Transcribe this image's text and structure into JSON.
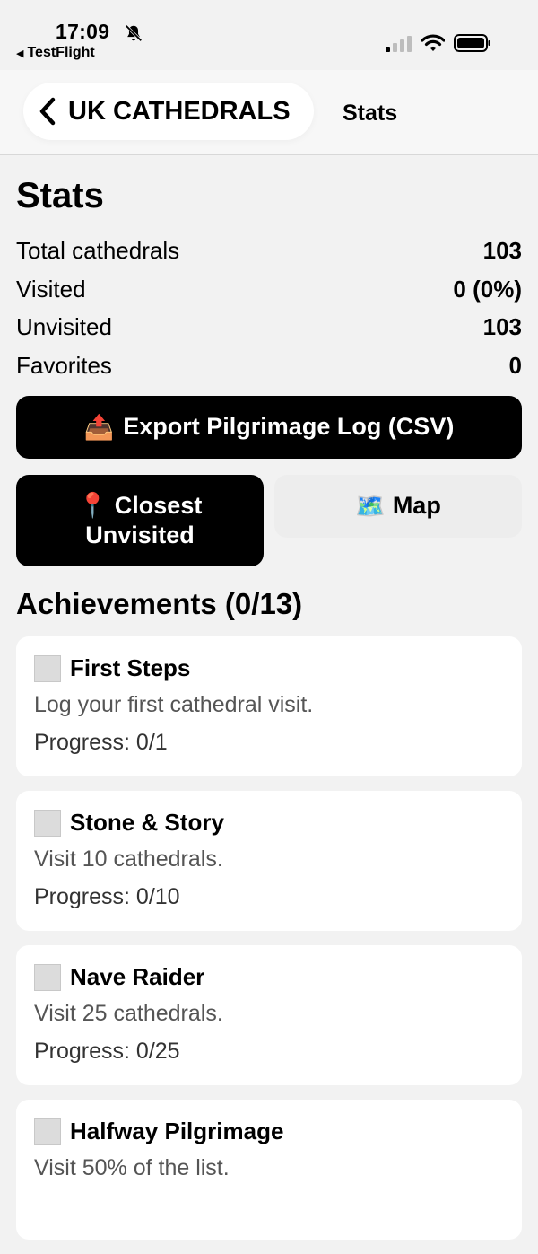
{
  "status_bar": {
    "time": "17:09",
    "back_app": "TestFlight",
    "icons": [
      "bell-slash-icon",
      "signal-icon",
      "wifi-icon",
      "battery-icon"
    ]
  },
  "nav": {
    "back_label": "UK CATHEDRALS",
    "title": "Stats"
  },
  "page": {
    "title": "Stats"
  },
  "stats": [
    {
      "label": "Total cathedrals",
      "value": "103"
    },
    {
      "label": "Visited",
      "value": "0 (0%)"
    },
    {
      "label": "Unvisited",
      "value": "103"
    },
    {
      "label": "Favorites",
      "value": "0"
    }
  ],
  "buttons": {
    "export": {
      "emoji": "📤",
      "label": "Export Pilgrimage Log (CSV)"
    },
    "closest": {
      "emoji": "📍",
      "line1": "Closest",
      "line2": "Unvisited"
    },
    "map": {
      "emoji": "🗺️",
      "label": "Map"
    }
  },
  "achievements": {
    "title": "Achievements (0/13)",
    "items": [
      {
        "title": "First Steps",
        "desc": "Log your first cathedral visit.",
        "progress": "Progress: 0/1"
      },
      {
        "title": "Stone & Story",
        "desc": "Visit 10 cathedrals.",
        "progress": "Progress: 0/10"
      },
      {
        "title": "Nave Raider",
        "desc": "Visit 25 cathedrals.",
        "progress": "Progress: 0/25"
      },
      {
        "title": "Halfway Pilgrimage",
        "desc": "Visit 50% of the list.",
        "progress": ""
      }
    ]
  },
  "colors": {
    "background": "#f2f2f2",
    "primary_button": "#000000",
    "secondary_button": "#ededed",
    "card": "#ffffff"
  }
}
